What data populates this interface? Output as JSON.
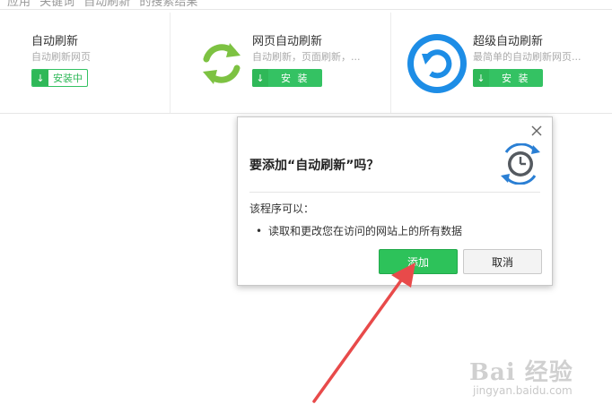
{
  "topbar": {
    "text": "\"应用\" 关键词 \"自动刷新\" 的搜索结果"
  },
  "cards": [
    {
      "title": "自动刷新",
      "desc": "自动刷新网页",
      "install_label": "安装中"
    },
    {
      "title": "网页自动刷新",
      "desc": "自动刷新，页面刷新，...",
      "install_label": "安 装",
      "icon": "green-refresh-icon"
    },
    {
      "title": "超级自动刷新",
      "desc": "最简单的自动刷新网页...",
      "install_label": "安 装",
      "icon": "blue-refresh-icon"
    }
  ],
  "dialog": {
    "title": "要添加“自动刷新”吗？",
    "perm_head": "该程序可以：",
    "perm_item": "读取和更改您在访问的网站上的所有数据",
    "add_label": "添加",
    "cancel_label": "取消"
  },
  "watermark": {
    "text": "Bai 经验",
    "sub": "jingyan.baidu.com"
  },
  "colors": {
    "accent_green": "#2dc25a",
    "annotation_red": "#e84a4a",
    "icon_blue": "#1d8de6"
  }
}
